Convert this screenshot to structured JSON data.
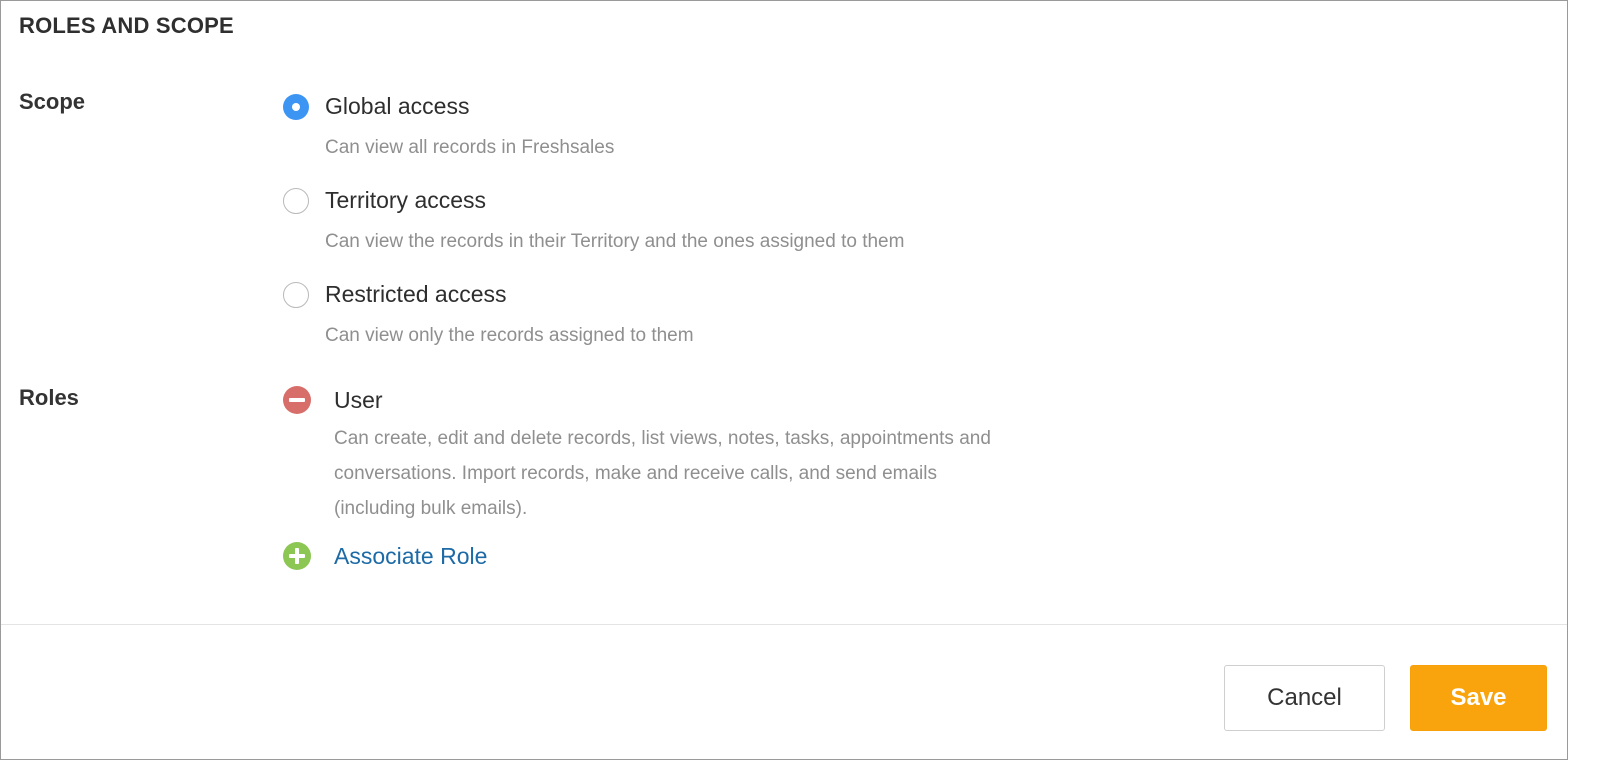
{
  "section": {
    "title": "ROLES AND SCOPE"
  },
  "scope": {
    "label": "Scope",
    "options": [
      {
        "label": "Global access",
        "description": "Can view all records in Freshsales",
        "selected": true
      },
      {
        "label": "Territory access",
        "description": "Can view the records in their Territory and the ones assigned to them",
        "selected": false
      },
      {
        "label": "Restricted access",
        "description": "Can view only the records assigned to them",
        "selected": false
      }
    ]
  },
  "roles": {
    "label": "Roles",
    "items": [
      {
        "name": "User",
        "description": "Can create, edit and delete records, list views, notes, tasks, appointments and conversations. Import records, make and receive calls, and send emails (including bulk emails).",
        "icon": "remove-circle-icon"
      }
    ],
    "associate_label": "Associate Role",
    "associate_icon": "add-circle-icon"
  },
  "footer": {
    "cancel_label": "Cancel",
    "save_label": "Save"
  },
  "colors": {
    "radio_selected": "#3d95f3",
    "remove_icon": "#d86e6a",
    "add_icon": "#8cc653",
    "link": "#1c6aa6",
    "save_button": "#f9a40d"
  }
}
